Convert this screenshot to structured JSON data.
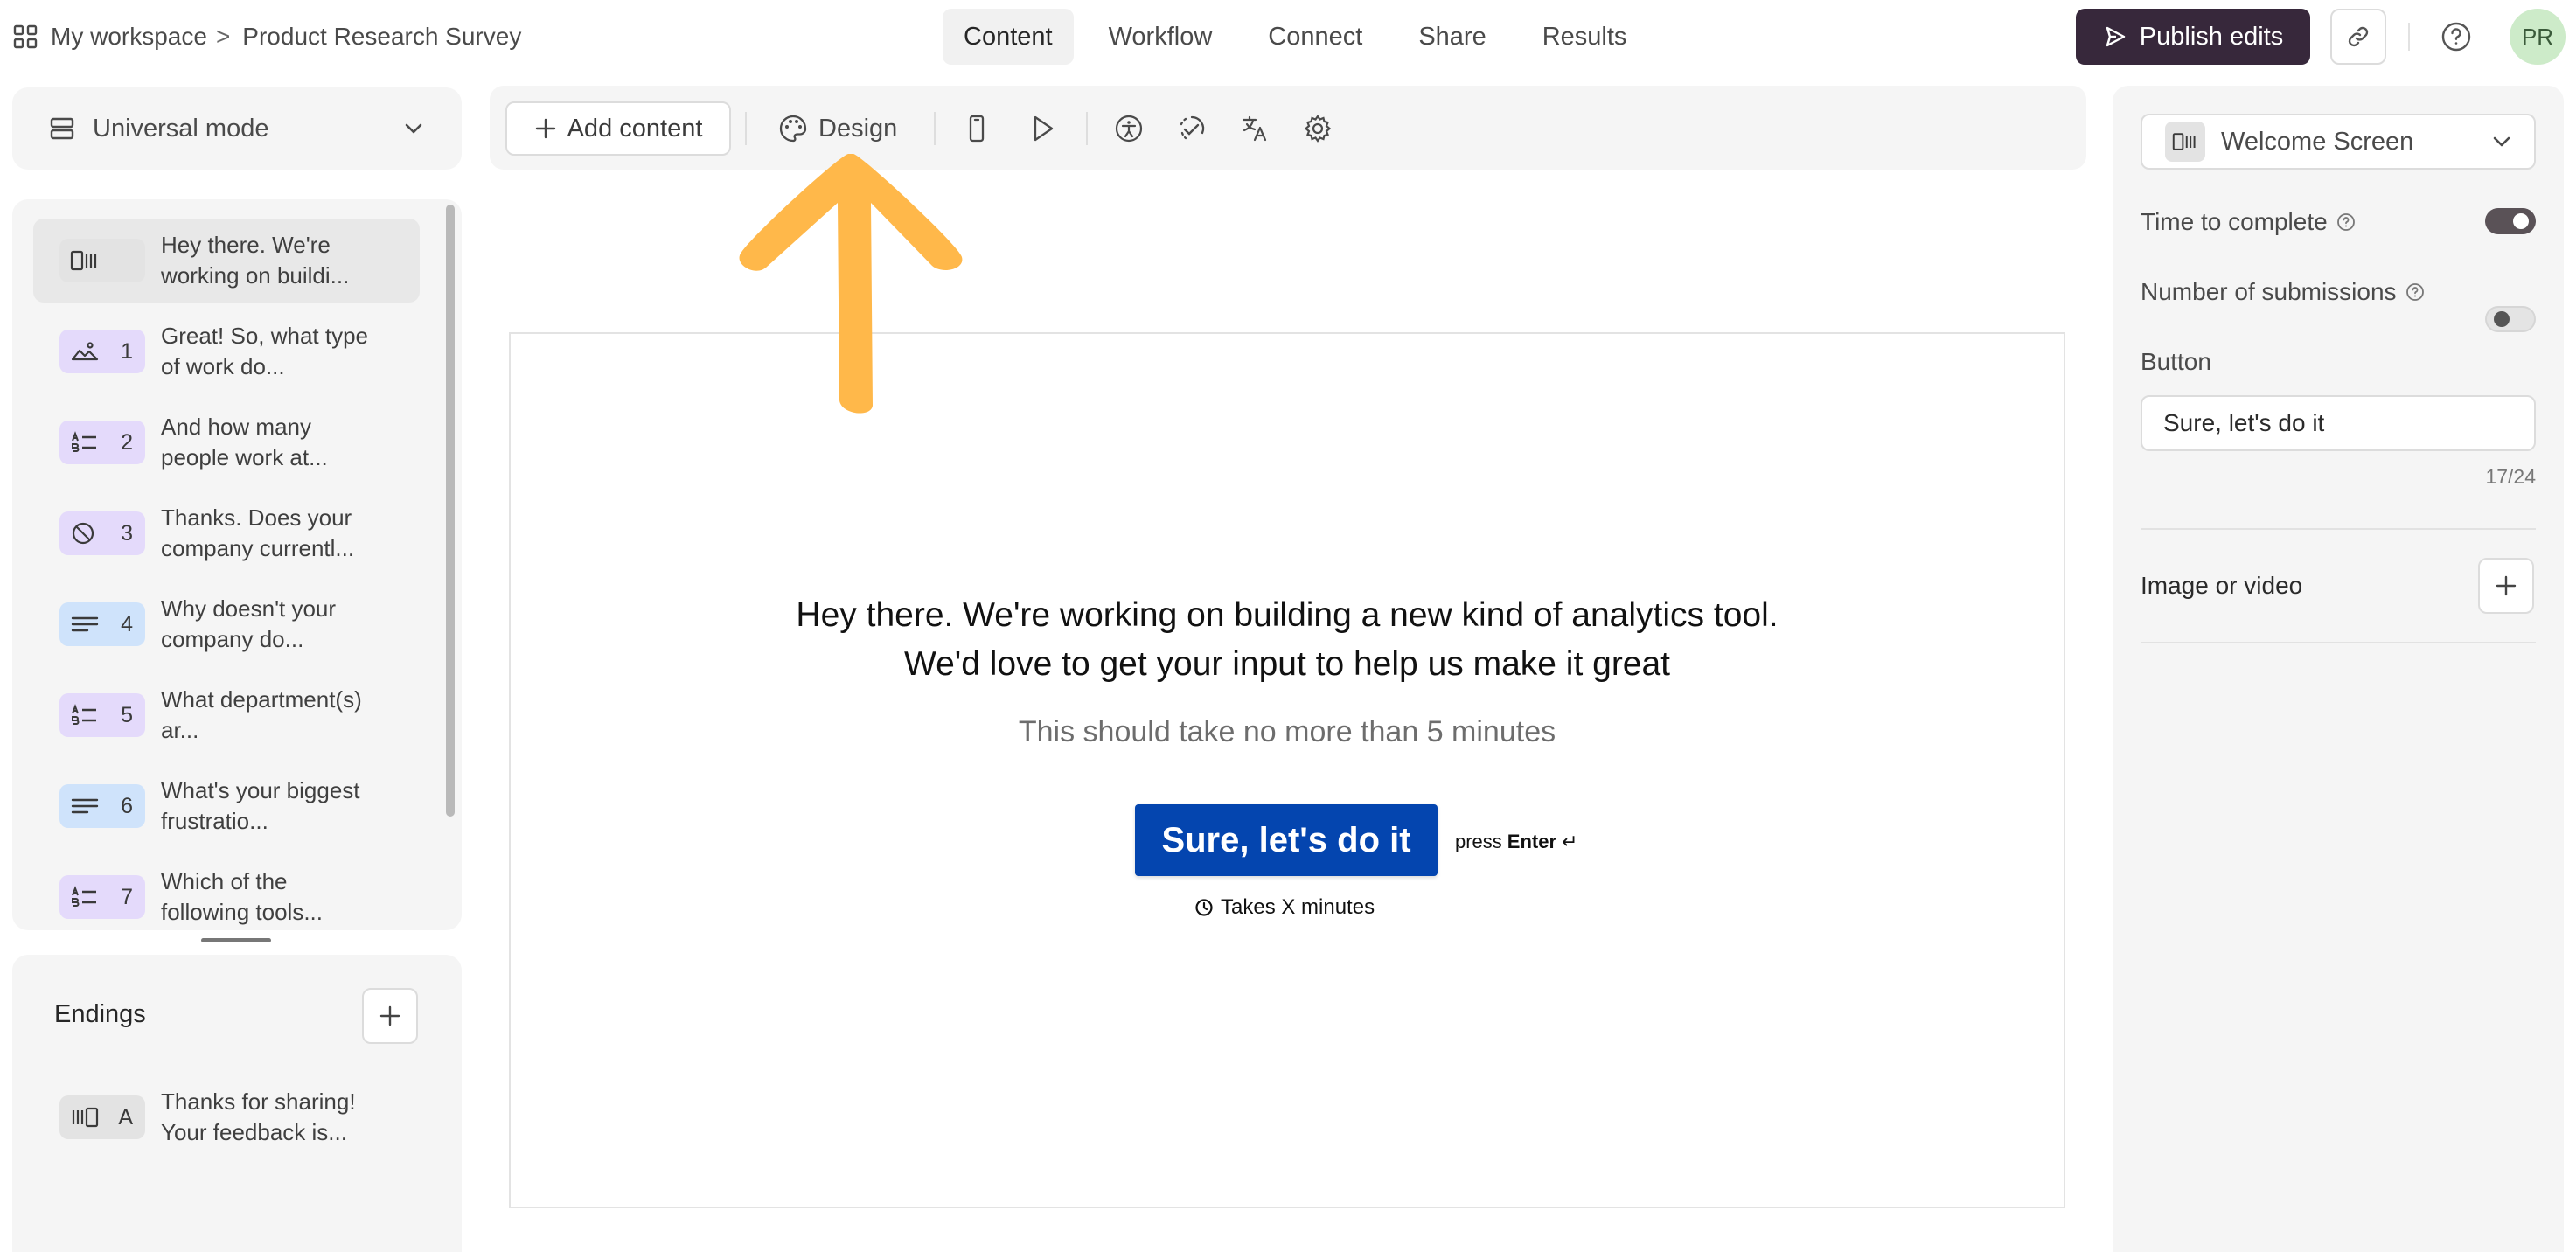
{
  "breadcrumb": {
    "workspace": "My workspace",
    "separator": ">",
    "form": "Product Research Survey"
  },
  "nav_tabs": [
    {
      "label": "Content",
      "active": true
    },
    {
      "label": "Workflow",
      "active": false
    },
    {
      "label": "Connect",
      "active": false
    },
    {
      "label": "Share",
      "active": false
    },
    {
      "label": "Results",
      "active": false
    }
  ],
  "header": {
    "publish_label": "Publish edits",
    "avatar_initials": "PR"
  },
  "mode": {
    "label": "Universal mode"
  },
  "questions": [
    {
      "number": "",
      "icon": "welcome-screen-icon",
      "color": "#e3e3e3",
      "text": "Hey there. We're working on buildi...",
      "active": true
    },
    {
      "number": "1",
      "icon": "picture-choice-icon",
      "color": "#e4dafb",
      "text": "Great! So, what type of work do..."
    },
    {
      "number": "2",
      "icon": "multiple-choice-icon",
      "color": "#e4dafb",
      "text": "And how many people work at..."
    },
    {
      "number": "3",
      "icon": "yes-no-icon",
      "color": "#e4dafb",
      "text": "Thanks. Does your company currentl..."
    },
    {
      "number": "4",
      "icon": "long-text-icon",
      "color": "#cfe3fb",
      "text": "Why doesn't your company do..."
    },
    {
      "number": "5",
      "icon": "multiple-choice-icon",
      "color": "#e4dafb",
      "text": "What department(s) ar..."
    },
    {
      "number": "6",
      "icon": "long-text-icon",
      "color": "#cfe3fb",
      "text": "What's your biggest frustratio..."
    },
    {
      "number": "7",
      "icon": "multiple-choice-icon",
      "color": "#e4dafb",
      "text": "Which of the following tools..."
    }
  ],
  "endings": {
    "title": "Endings",
    "items": [
      {
        "letter": "A",
        "icon": "ending-screen-icon",
        "text": "Thanks for sharing! Your feedback is..."
      }
    ]
  },
  "toolbar": {
    "add_content": "Add content",
    "design": "Design"
  },
  "welcome": {
    "title_line1": "Hey there. We're working on building a new kind of analytics tool.",
    "title_line2": "We'd love to get your input to help us make it great",
    "subtitle": "This should take no more than 5 minutes",
    "button": "Sure, let's do it",
    "press": "press",
    "enter": "Enter",
    "enter_glyph": "↵",
    "takes": "Takes X minutes"
  },
  "right_panel": {
    "screen_type": "Welcome Screen",
    "time_to_complete": {
      "label": "Time to complete",
      "on": true
    },
    "number_of_submissions": {
      "label": "Number of submissions",
      "on": false
    },
    "button_section": "Button",
    "button_value": "Sure, let's do it",
    "char_count": "17/24",
    "image_or_video": "Image or video"
  },
  "colors": {
    "brand_button": "#0445af",
    "publish": "#37283b",
    "annotation_arrow": "#ffb84a"
  }
}
